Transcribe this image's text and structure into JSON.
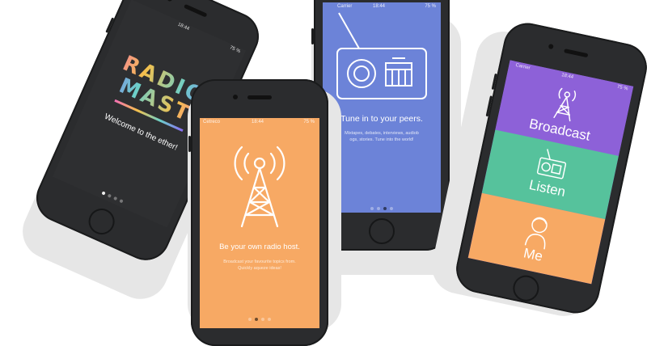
{
  "phone1": {
    "status": {
      "time": "18:44",
      "battery": "75 %"
    },
    "logo": {
      "line1": "RADIO",
      "line2": "MAST"
    },
    "tagline": "Welcome to the ether!",
    "colors": {
      "screen": "#2e2f31",
      "logo_gradient": [
        "#f36fb5",
        "#f4c04c",
        "#6cd0c9",
        "#8a6cf3"
      ]
    }
  },
  "phone2": {
    "status": {
      "carrier": "Cetreco",
      "time": "18:44",
      "battery": "75 %"
    },
    "icon": "antenna-tower-icon",
    "headline": "Be your own radio host.",
    "subtext": "Broadcast your favourite topics from. Quickly aqueze ideas!",
    "colors": {
      "screen": "#f7a964"
    }
  },
  "phone3": {
    "status": {
      "carrier": "Carrier",
      "time": "18:44",
      "battery": "75 %"
    },
    "icon": "radio-icon",
    "headline": "Tune in to your peers.",
    "subtext": "Mixtapes, debates, interviews, audiob ogs, stories. Tune into the world!",
    "colors": {
      "screen": "#6c83d8"
    }
  },
  "phone4": {
    "status": {
      "carrier": "Carrier",
      "time": "18:44",
      "battery": "75 %"
    },
    "menu": [
      {
        "label": "Broadcast",
        "icon": "antenna-tower-icon",
        "color": "#8d61d8"
      },
      {
        "label": "Listen",
        "icon": "radio-icon",
        "color": "#56c29c"
      },
      {
        "label": "Me",
        "icon": "person-icon",
        "color": "#f7a964"
      }
    ]
  }
}
